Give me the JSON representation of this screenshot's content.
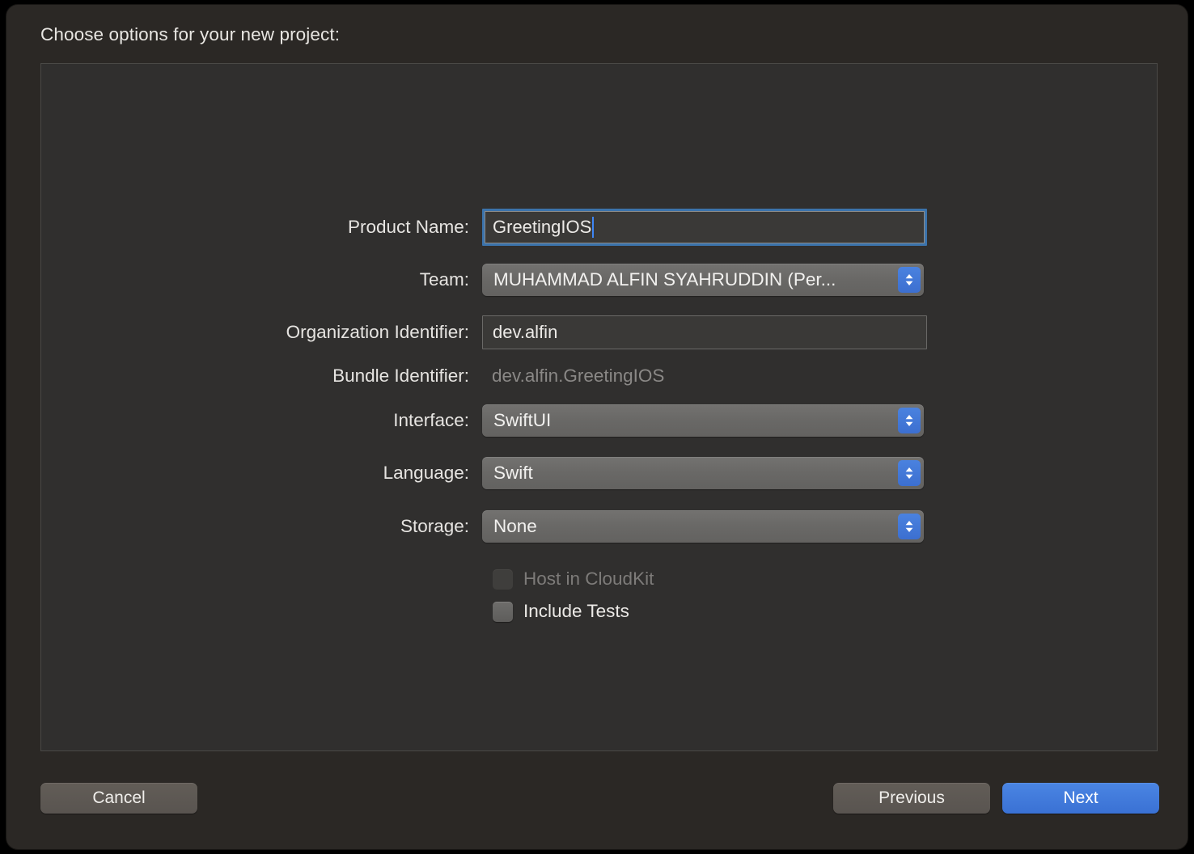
{
  "dialog": {
    "heading": "Choose options for your new project:"
  },
  "form": {
    "rows": [
      {
        "label": "Product Name:",
        "type": "textfield-focused",
        "value": "GreetingIOS",
        "placeholder": ""
      },
      {
        "label": "Team:",
        "type": "popup",
        "value": "MUHAMMAD ALFIN SYAHRUDDIN (Per..."
      },
      {
        "label": "Organization Identifier:",
        "type": "textfield",
        "value": "dev.alfin",
        "placeholder": ""
      },
      {
        "label": "Bundle Identifier:",
        "type": "static",
        "value": "dev.alfin.GreetingIOS"
      },
      {
        "label": "Interface:",
        "type": "popup",
        "value": "SwiftUI"
      },
      {
        "label": "Language:",
        "type": "popup",
        "value": "Swift"
      },
      {
        "label": "Storage:",
        "type": "popup",
        "value": "None"
      }
    ],
    "checkboxes": [
      {
        "label": "Host in CloudKit",
        "checked": false,
        "enabled": false
      },
      {
        "label": "Include Tests",
        "checked": false,
        "enabled": true
      }
    ]
  },
  "footer": {
    "cancel_label": "Cancel",
    "previous_label": "Previous",
    "next_label": "Next"
  },
  "colors": {
    "window_background": "#2b2825",
    "panel_background": "#302f2e",
    "accent_blue": "#3a71d4",
    "focus_ring": "#3b73ab",
    "popup_gray": "#696866",
    "text_primary": "#e8e6e2",
    "text_dim": "#8a8886"
  }
}
